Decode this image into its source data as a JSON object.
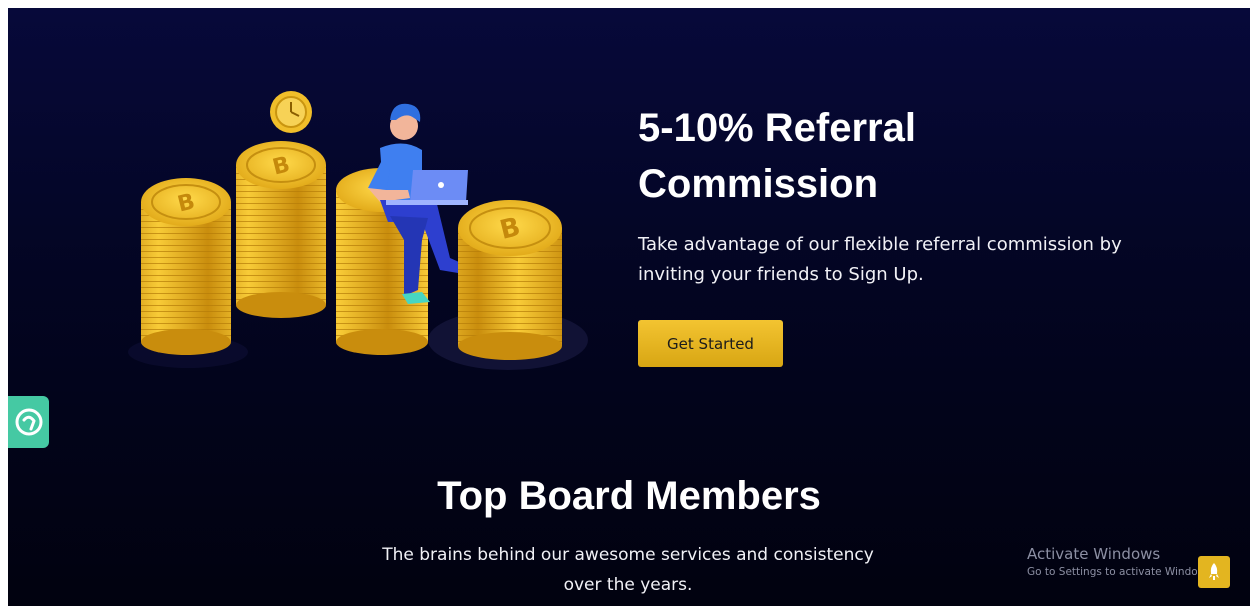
{
  "hero": {
    "title_line1": "5-10% Referral",
    "title_line2": "Commission",
    "description": "Take advantage of our flexible referral commission by inviting your friends to Sign Up.",
    "cta_label": "Get Started"
  },
  "board": {
    "title": "Top Board Members",
    "subtitle": "The brains behind our awesome services and consistency over the years."
  },
  "watermark": {
    "line1": "Activate Windows",
    "line2": "Go to Settings to activate Windows."
  },
  "colors": {
    "background": "#030522",
    "accent_gold": "#e3b520",
    "support_green": "#45c9a3"
  },
  "icons": {
    "support_widget": "chat-support-icon",
    "scroll_top": "rocket-icon"
  }
}
